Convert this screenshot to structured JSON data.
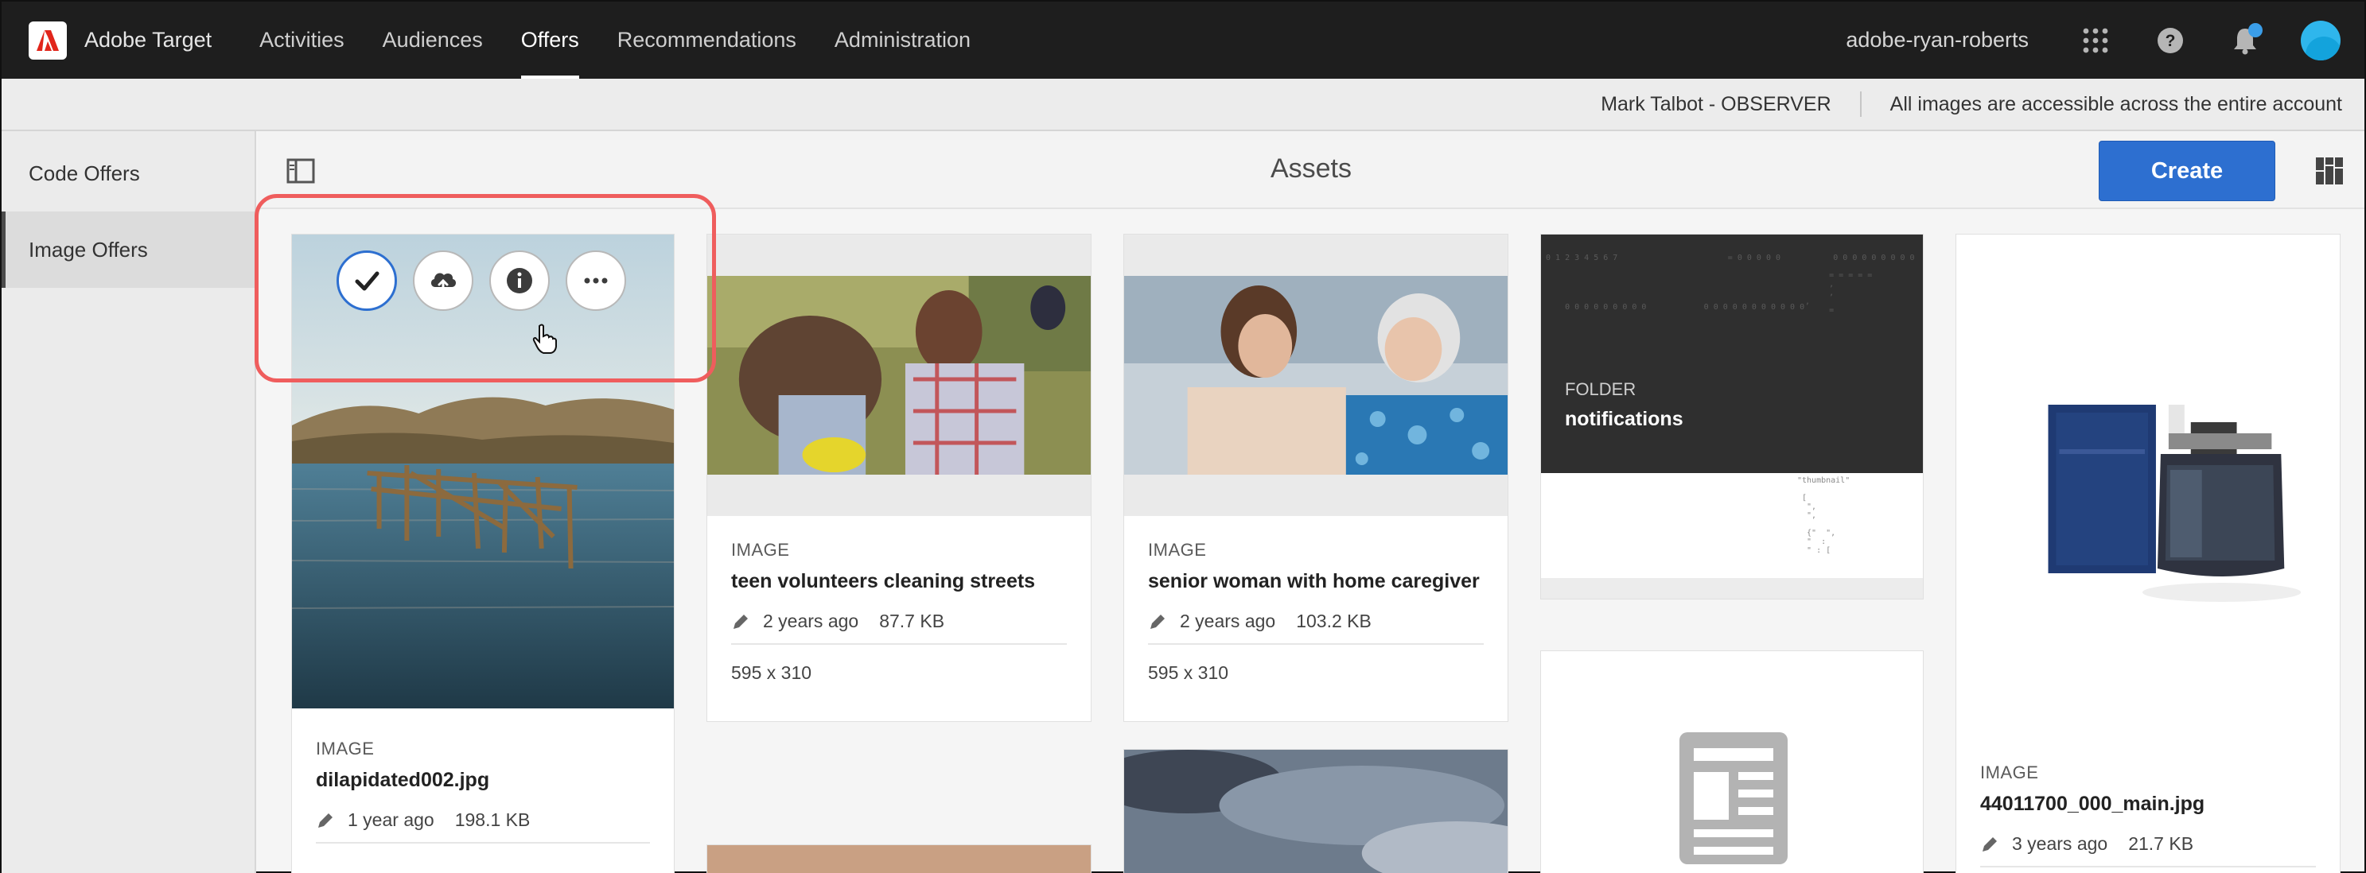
{
  "topnav": {
    "product": "Adobe Target",
    "items": [
      "Activities",
      "Audiences",
      "Offers",
      "Recommendations",
      "Administration"
    ],
    "active": "Offers",
    "account": "adobe-ryan-roberts"
  },
  "infobar": {
    "user": "Mark Talbot - OBSERVER",
    "message": "All images are accessible across the entire account"
  },
  "sidebar": {
    "items": [
      {
        "label": "Code Offers"
      },
      {
        "label": "Image Offers"
      }
    ],
    "active": "Image Offers"
  },
  "header": {
    "title": "Assets",
    "create_label": "Create"
  },
  "cards": [
    {
      "type": "IMAGE",
      "title": "dilapidated002.jpg",
      "modified": "1 year ago",
      "size": "198.1 KB"
    },
    {
      "type": "IMAGE",
      "title": "teen volunteers cleaning streets",
      "modified": "2 years ago",
      "size": "87.7 KB",
      "dims": "595 x 310"
    },
    {
      "type": "IMAGE",
      "title": "senior woman with home caregiver",
      "modified": "2 years ago",
      "size": "103.2 KB",
      "dims": "595 x 310"
    },
    {
      "type": "FOLDER",
      "title": "notifications"
    },
    {
      "type": "IMAGE",
      "title": "44011700_000_main.jpg",
      "modified": "3 years ago",
      "size": "21.7 KB"
    }
  ],
  "quick_actions": [
    "check-icon",
    "cloud-upload-icon",
    "info-icon",
    "more-icon"
  ],
  "colors": {
    "accent": "#2d6fd0",
    "highlight": "#ef5d5d",
    "topbar": "#1e1e1e"
  }
}
